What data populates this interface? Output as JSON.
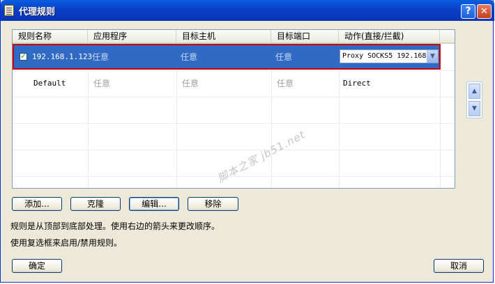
{
  "window": {
    "title": "代理规则",
    "help_label": "?",
    "close_label": "✕"
  },
  "table": {
    "columns": [
      "规则名称",
      "应用程序",
      "目标主机",
      "目标端口",
      "动作(直接/拦截)"
    ],
    "rows": [
      {
        "checked": true,
        "name": "192.168.1.123",
        "app": "任意",
        "host": "任意",
        "port": "任意",
        "action": "Proxy SOCKS5 192.168",
        "selected": true
      },
      {
        "checked": false,
        "name": "Default",
        "app": "任意",
        "host": "任意",
        "port": "任意",
        "action": "Direct",
        "selected": false
      }
    ]
  },
  "buttons": {
    "add": "添加...",
    "clone": "克隆",
    "edit": "编辑...",
    "remove": "移除",
    "ok": "确定",
    "cancel": "取消"
  },
  "hints": {
    "line1": "规则是从顶部到底部处理。使用右边的箭头来更改顺序。",
    "line2": "使用复选框来启用/禁用规则。"
  },
  "watermark": "脚本之家 jb51.net",
  "colors": {
    "selection": "#316ac5",
    "selection_outline": "#cc0000",
    "titlebar": "#0a3fc6"
  }
}
